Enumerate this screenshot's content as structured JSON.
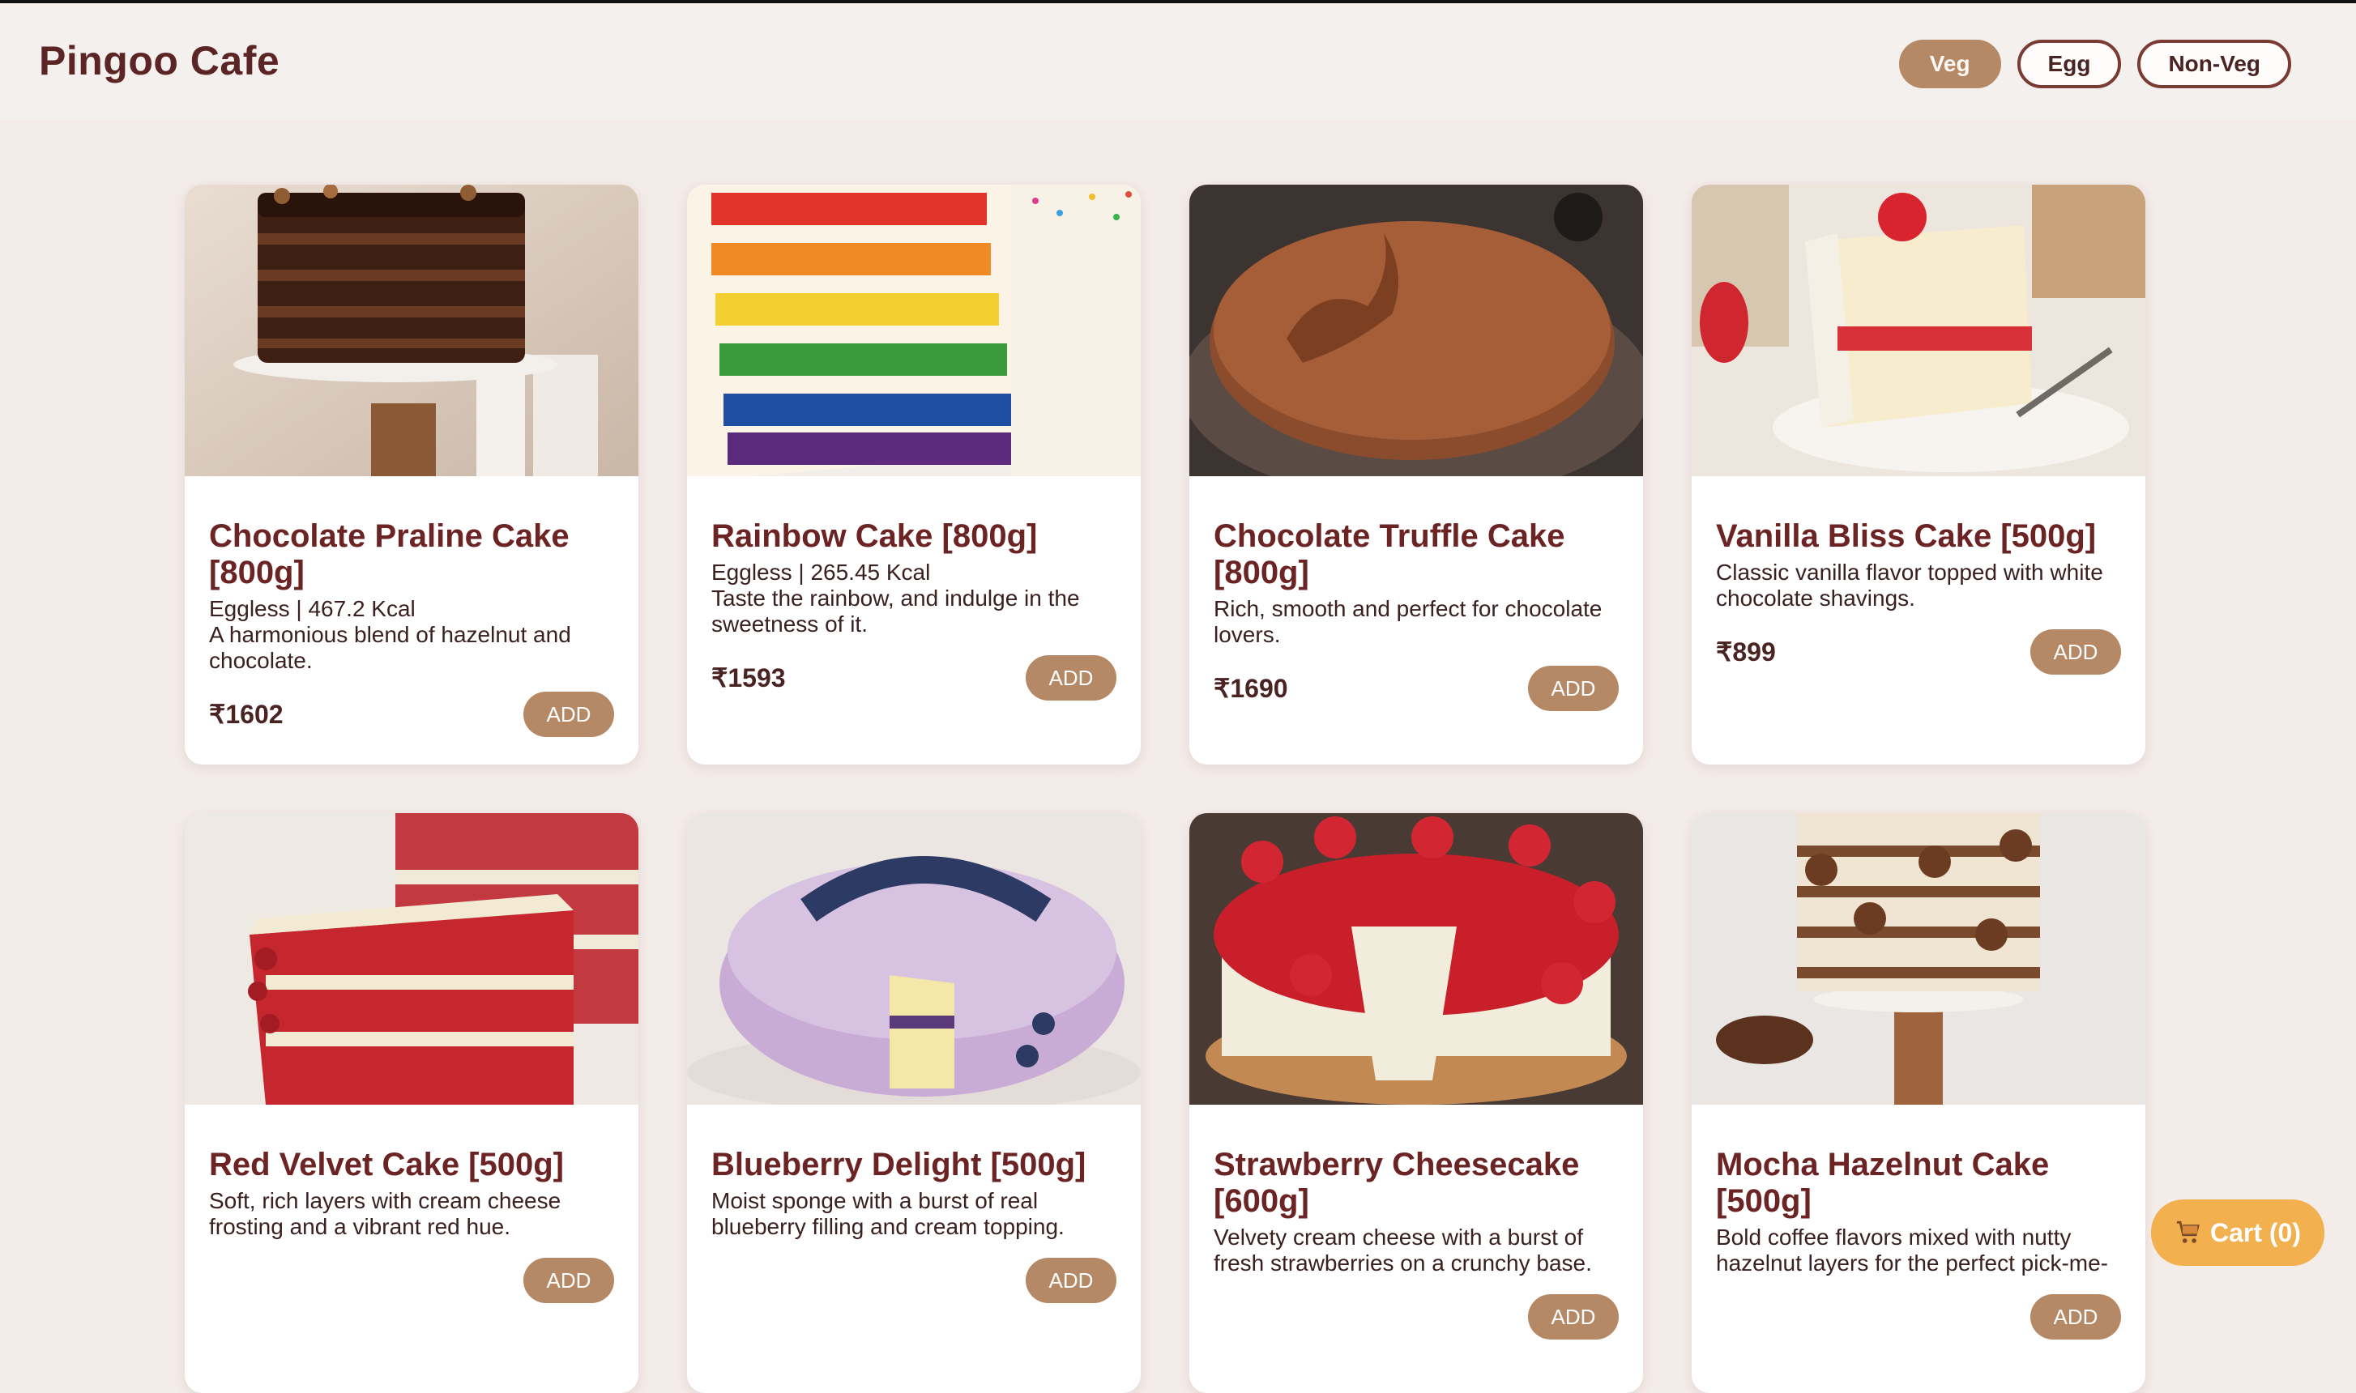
{
  "brand": "Pingoo Cafe",
  "filters": [
    {
      "label": "Veg",
      "active": true
    },
    {
      "label": "Egg",
      "active": false
    },
    {
      "label": "Non-Veg",
      "active": false
    }
  ],
  "add_label": "ADD",
  "cart": {
    "label": "Cart (0)",
    "icon": "cart-icon"
  },
  "colors": {
    "accent": "#b58866",
    "title": "#6b2323",
    "cart": "#f2b04e"
  },
  "products": [
    {
      "name": "Chocolate Praline Cake [800g]",
      "meta": "Eggless | 467.2 Kcal",
      "desc": "A harmonious blend of hazelnut and chocolate.",
      "price": "₹1602",
      "image": "chocolate-praline-cake-photo"
    },
    {
      "name": "Rainbow Cake [800g]",
      "meta": "Eggless | 265.45 Kcal",
      "desc": "Taste the rainbow, and indulge in the sweetness of it.",
      "price": "₹1593",
      "image": "rainbow-cake-photo"
    },
    {
      "name": "Chocolate Truffle Cake [800g]",
      "meta": "",
      "desc": "Rich, smooth and perfect for chocolate lovers.",
      "price": "₹1690",
      "image": "chocolate-truffle-cake-photo"
    },
    {
      "name": "Vanilla Bliss Cake [500g]",
      "meta": "",
      "desc": "Classic vanilla flavor topped with white chocolate shavings.",
      "price": "₹899",
      "image": "vanilla-bliss-cake-photo"
    },
    {
      "name": "Red Velvet Cake [500g]",
      "meta": "",
      "desc": "Soft, rich layers with cream cheese frosting and a vibrant red hue.",
      "price": "",
      "image": "red-velvet-cake-photo"
    },
    {
      "name": "Blueberry Delight [500g]",
      "meta": "",
      "desc": "Moist sponge with a burst of real blueberry filling and cream topping.",
      "price": "",
      "image": "blueberry-delight-cake-photo"
    },
    {
      "name": "Strawberry Cheesecake [600g]",
      "meta": "",
      "desc": "Velvety cream cheese with a burst of fresh strawberries on a crunchy base.",
      "price": "",
      "image": "strawberry-cheesecake-photo"
    },
    {
      "name": "Mocha Hazelnut Cake [500g]",
      "meta": "",
      "desc": "Bold coffee flavors mixed with nutty hazelnut layers for the perfect pick-me-",
      "price": "",
      "image": "mocha-hazelnut-cake-photo"
    }
  ]
}
